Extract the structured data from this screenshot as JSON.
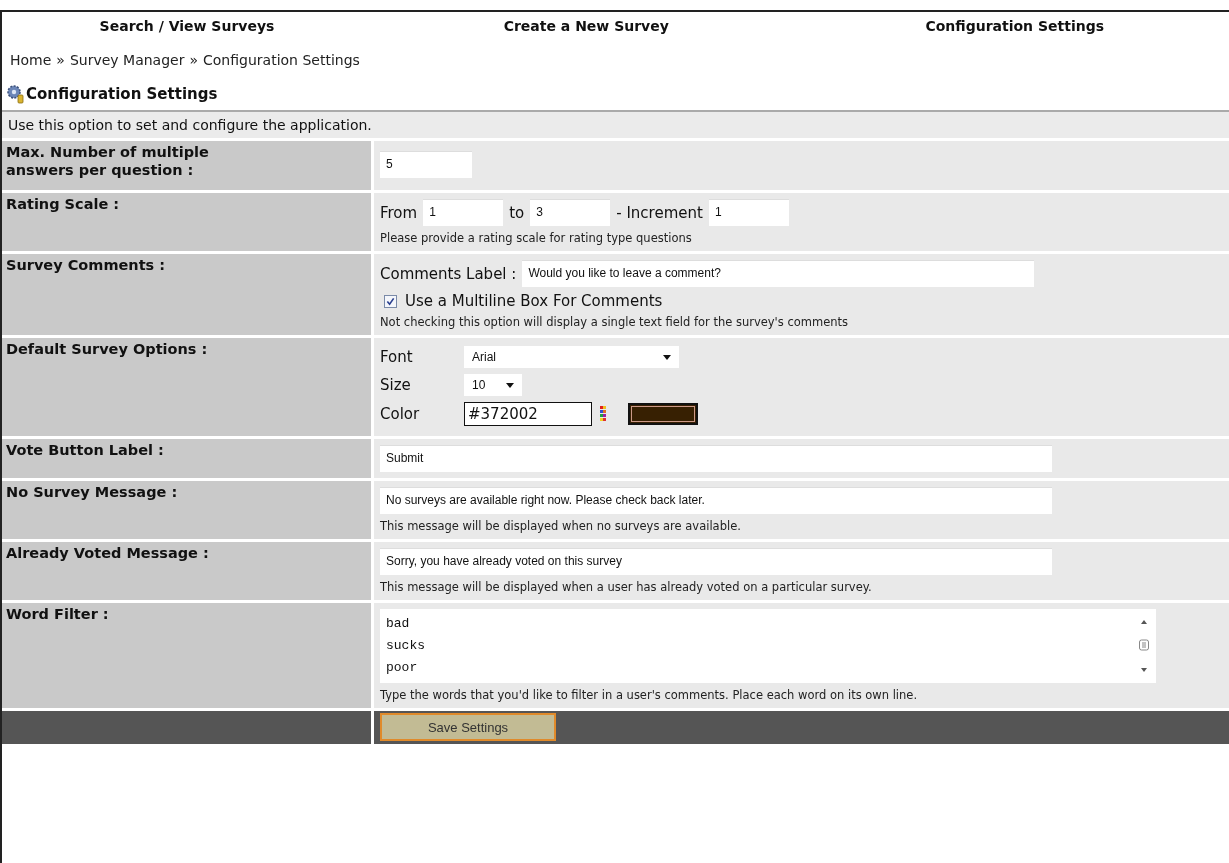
{
  "nav": [
    {
      "label": "Search / View Surveys"
    },
    {
      "label": "Create a New Survey"
    },
    {
      "label": "Configuration Settings"
    }
  ],
  "breadcrumb": {
    "items": [
      "Home",
      "Survey Manager",
      "Configuration Settings"
    ],
    "separator": "»"
  },
  "heading": "Configuration Settings",
  "intro": "Use this option to set and configure the application.",
  "rows": [
    {
      "kind": "number",
      "label": "Max. Number of multiple answers per question :",
      "value": "5"
    },
    {
      "kind": "range",
      "label": "Rating Scale :",
      "from_label": "From",
      "from": "1",
      "to_label": "to",
      "to": "3",
      "increment_label": "- Increment",
      "increment": "1",
      "hint": "Please provide a rating scale for rating type questions"
    },
    {
      "kind": "comments",
      "label": "Survey Comments :",
      "field_label": "Comments Label :",
      "value": "Would you like to leave a comment?",
      "checkbox": {
        "label": "Use a Multiline Box For Comments",
        "checked": true
      },
      "hint": "Not checking this option will display a single text field for the survey's comments"
    },
    {
      "kind": "options",
      "label": "Default Survey Options :",
      "font": {
        "label": "Font",
        "value": "Arial"
      },
      "size": {
        "label": "Size",
        "value": "10"
      },
      "color": {
        "label": "Color",
        "value": "#372002",
        "color": "#372002"
      }
    },
    {
      "kind": "text",
      "label": "Vote Button Label :",
      "value": "Submit"
    },
    {
      "kind": "text",
      "label": "No Survey Message :",
      "value": "No surveys are available right now. Please check back later.",
      "hint": "This message will be displayed when no surveys are available."
    },
    {
      "kind": "text",
      "label": "Already Voted Message :",
      "value": "Sorry, you have already voted on this survey",
      "hint": "This message will be displayed when a user has already voted on a particular survey."
    },
    {
      "kind": "textarea",
      "label": "Word Filter :",
      "lines": [
        "bad",
        "sucks",
        "poor"
      ],
      "hint": "Type the words that you'd like to filter in a user's comments. Place each word on its own line."
    }
  ],
  "save_button": "Save Settings"
}
